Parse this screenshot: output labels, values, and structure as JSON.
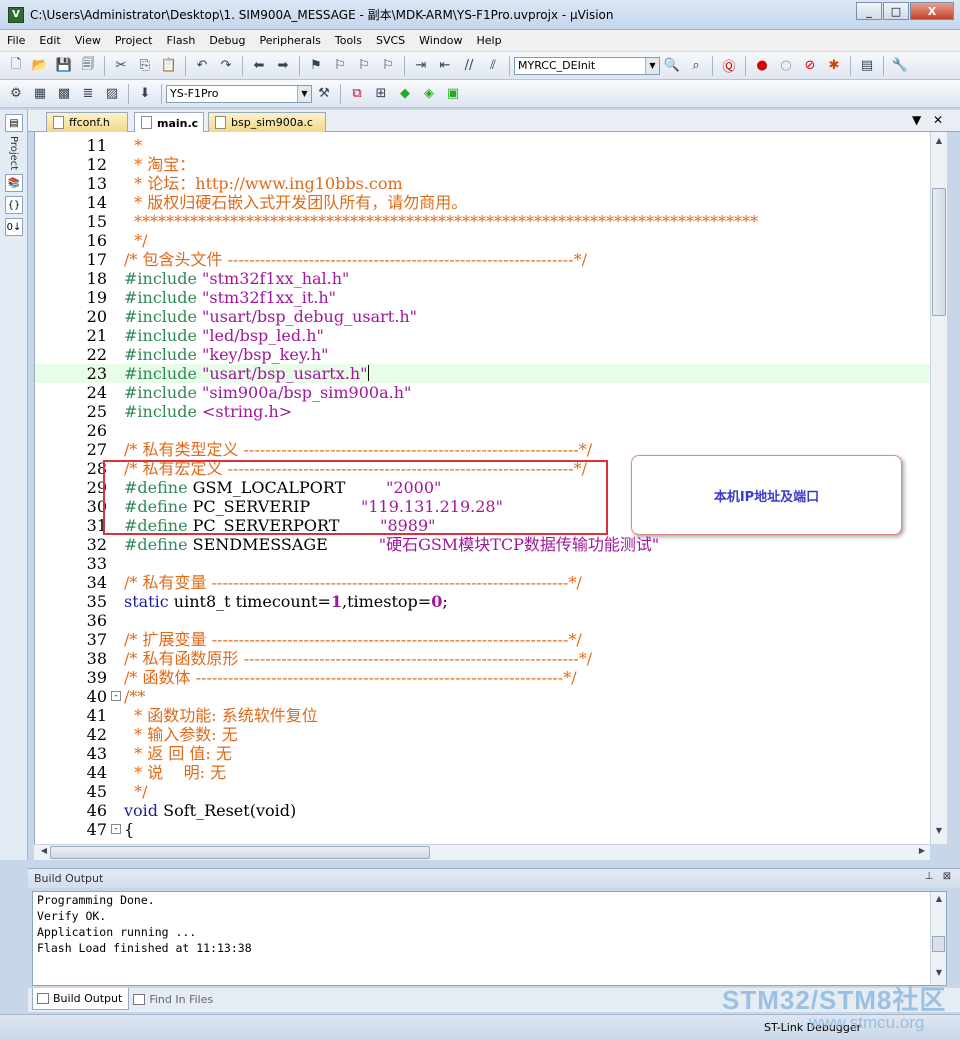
{
  "window": {
    "title": "C:\\Users\\Administrator\\Desktop\\1. SIM900A_MESSAGE - 副本\\MDK-ARM\\YS-F1Pro.uvprojx - µVision",
    "icon_label": "V",
    "minimize": "_",
    "maximize": "□",
    "close": "X"
  },
  "menu": [
    "File",
    "Edit",
    "View",
    "Project",
    "Flash",
    "Debug",
    "Peripherals",
    "Tools",
    "SVCS",
    "Window",
    "Help"
  ],
  "toolbar": {
    "function_combo": "MYRCC_DEInit",
    "target_combo": "YS-F1Pro"
  },
  "sidebar": {
    "project_label": "Project"
  },
  "tabs": [
    {
      "label": "ffconf.h",
      "active": false
    },
    {
      "label": "main.c",
      "active": true
    },
    {
      "label": "bsp_sim900a.c",
      "active": false
    }
  ],
  "editor": {
    "lines": [
      {
        "n": "11",
        "t": [
          [
            "c-com",
            "  *"
          ]
        ]
      },
      {
        "n": "12",
        "t": [
          [
            "c-com",
            "  * 淘宝："
          ]
        ]
      },
      {
        "n": "13",
        "t": [
          [
            "c-com",
            "  * 论坛：http://www.ing10bbs.com"
          ]
        ]
      },
      {
        "n": "14",
        "t": [
          [
            "c-com",
            "  * 版权归硬石嵌入式开发团队所有，请勿商用。"
          ]
        ]
      },
      {
        "n": "15",
        "t": [
          [
            "c-com",
            "  ******************************************************************************"
          ]
        ]
      },
      {
        "n": "16",
        "t": [
          [
            "c-com",
            "  */"
          ]
        ]
      },
      {
        "n": "17",
        "t": [
          [
            "c-com",
            "/* 包含头文件 ----------------------------------------------------------------*/"
          ]
        ]
      },
      {
        "n": "18",
        "t": [
          [
            "c-pp",
            "#include "
          ],
          [
            "c-str",
            "\"stm32f1xx_hal.h\""
          ]
        ]
      },
      {
        "n": "19",
        "t": [
          [
            "c-pp",
            "#include "
          ],
          [
            "c-str",
            "\"stm32f1xx_it.h\""
          ]
        ]
      },
      {
        "n": "20",
        "t": [
          [
            "c-pp",
            "#include "
          ],
          [
            "c-str",
            "\"usart/bsp_debug_usart.h\""
          ]
        ]
      },
      {
        "n": "21",
        "t": [
          [
            "c-pp",
            "#include "
          ],
          [
            "c-str",
            "\"led/bsp_led.h\""
          ]
        ]
      },
      {
        "n": "22",
        "t": [
          [
            "c-pp",
            "#include "
          ],
          [
            "c-str",
            "\"key/bsp_key.h\""
          ]
        ]
      },
      {
        "n": "23",
        "t": [
          [
            "c-pp",
            "#include "
          ],
          [
            "c-str",
            "\"usart/bsp_usartx.h\""
          ]
        ],
        "highlight": true,
        "caret": true
      },
      {
        "n": "24",
        "t": [
          [
            "c-pp",
            "#include "
          ],
          [
            "c-str",
            "\"sim900a/bsp_sim900a.h\""
          ]
        ]
      },
      {
        "n": "25",
        "t": [
          [
            "c-pp",
            "#include "
          ],
          [
            "c-str",
            "<string.h>"
          ]
        ]
      },
      {
        "n": "26",
        "t": [
          [
            "c-txt",
            ""
          ]
        ]
      },
      {
        "n": "27",
        "t": [
          [
            "c-com",
            "/* 私有类型定义 --------------------------------------------------------------*/"
          ]
        ]
      },
      {
        "n": "28",
        "t": [
          [
            "c-com",
            "/* 私有宏定义 ----------------------------------------------------------------*/"
          ]
        ]
      },
      {
        "n": "29",
        "t": [
          [
            "c-pp",
            "#define "
          ],
          [
            "c-txt",
            "GSM_LOCALPORT        "
          ],
          [
            "c-str",
            "\"2000\""
          ]
        ]
      },
      {
        "n": "30",
        "t": [
          [
            "c-pp",
            "#define "
          ],
          [
            "c-txt",
            "PC_SERVERIP          "
          ],
          [
            "c-str",
            "\"119.131.219.28\""
          ]
        ]
      },
      {
        "n": "31",
        "t": [
          [
            "c-pp",
            "#define "
          ],
          [
            "c-txt",
            "PC_SERVERPORT        "
          ],
          [
            "c-str",
            "\"8989\""
          ]
        ]
      },
      {
        "n": "32",
        "t": [
          [
            "c-pp",
            "#define "
          ],
          [
            "c-txt",
            "SENDMESSAGE          "
          ],
          [
            "c-str",
            "\"硬石GSM模块TCP数据传输功能测试\""
          ]
        ]
      },
      {
        "n": "33",
        "t": [
          [
            "c-txt",
            ""
          ]
        ]
      },
      {
        "n": "34",
        "t": [
          [
            "c-com",
            "/* 私有变量 ------------------------------------------------------------------*/"
          ]
        ]
      },
      {
        "n": "35",
        "t": [
          [
            "c-kw",
            "static "
          ],
          [
            "c-txt",
            "uint8_t timecount="
          ],
          [
            "c-num",
            "1"
          ],
          [
            "c-txt",
            ",timestop="
          ],
          [
            "c-num",
            "0"
          ],
          [
            "c-txt",
            ";"
          ]
        ]
      },
      {
        "n": "36",
        "t": [
          [
            "c-txt",
            ""
          ]
        ]
      },
      {
        "n": "37",
        "t": [
          [
            "c-com",
            "/* 扩展变量 ------------------------------------------------------------------*/"
          ]
        ]
      },
      {
        "n": "38",
        "t": [
          [
            "c-com",
            "/* 私有函数原形 --------------------------------------------------------------*/"
          ]
        ]
      },
      {
        "n": "39",
        "t": [
          [
            "c-com",
            "/* 函数体 --------------------------------------------------------------------*/"
          ]
        ]
      },
      {
        "n": "40",
        "t": [
          [
            "c-com",
            "/**"
          ]
        ],
        "fold": "-"
      },
      {
        "n": "41",
        "t": [
          [
            "c-com",
            "  * 函数功能: 系统软件复位"
          ]
        ]
      },
      {
        "n": "42",
        "t": [
          [
            "c-com",
            "  * 输入参数: 无"
          ]
        ]
      },
      {
        "n": "43",
        "t": [
          [
            "c-com",
            "  * 返 回 值: 无"
          ]
        ]
      },
      {
        "n": "44",
        "t": [
          [
            "c-com",
            "  * 说    明: 无"
          ]
        ]
      },
      {
        "n": "45",
        "t": [
          [
            "c-com",
            "  */"
          ]
        ]
      },
      {
        "n": "46",
        "t": [
          [
            "c-kw",
            "void "
          ],
          [
            "c-txt",
            "Soft_Reset(void)"
          ]
        ]
      },
      {
        "n": "47",
        "t": [
          [
            "c-txt",
            "{"
          ]
        ],
        "fold": "-"
      }
    ]
  },
  "annotation": {
    "callout_text": "本机IP地址及端口"
  },
  "build_output": {
    "title": "Build Output",
    "lines": [
      "Programming Done.",
      "Verify OK.",
      "Application running ...",
      "Flash Load finished at 11:13:38"
    ],
    "tabs": [
      "Build Output",
      "Find In Files"
    ]
  },
  "status": {
    "debugger": "ST-Link Debugger"
  },
  "watermark": {
    "line1": "STM32/STM8社区",
    "line2": "www.stmcu.org"
  }
}
